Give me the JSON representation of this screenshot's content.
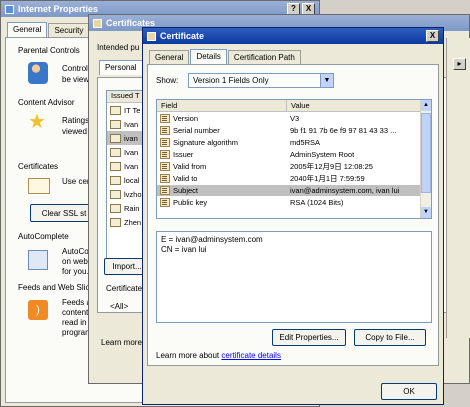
{
  "ie": {
    "title": "Internet Properties",
    "tabs": [
      "General",
      "Security"
    ],
    "sections": {
      "parental": {
        "heading": "Parental Controls",
        "line1": "Control",
        "line2": "be viewe"
      },
      "advisor": {
        "heading": "Content Advisor",
        "line1": "Ratings",
        "line2": "viewed o"
      },
      "certs": {
        "heading": "Certificates",
        "line1": "Use cert",
        "clear_ssl": "Clear SSL st"
      },
      "autocomplete": {
        "heading": "AutoComplete",
        "line1": "AutoCo",
        "line2": "on webp",
        "line3": "for you."
      },
      "feeds": {
        "heading": "Feeds and Web Slic",
        "line1": "Feeds a",
        "line2": "content",
        "line3": "read in I",
        "line4": "program"
      }
    }
  },
  "certs_dialog": {
    "title": "Certificates",
    "intended": "Intended pu",
    "tab_personal": "Personal",
    "issued_header": "Issued T",
    "items": [
      "IT Te",
      "Ivan",
      "ivan",
      "Ivan",
      "Ivan",
      "local",
      "lvzho",
      "Rain",
      "Zhen"
    ],
    "import_btn": "Import...",
    "purposes_label": "Certificate",
    "purposes_value": "<All>",
    "learn_more": "Learn more"
  },
  "cert": {
    "title": "Certificate",
    "tabs": [
      "General",
      "Details",
      "Certification Path"
    ],
    "show_label": "Show:",
    "show_value": "Version 1 Fields Only",
    "columns": {
      "field": "Field",
      "value": "Value"
    },
    "fields": [
      {
        "field": "Version",
        "value": "V3"
      },
      {
        "field": "Serial number",
        "value": "9b f1 91 7b 6e f9 97 81 43 33 ..."
      },
      {
        "field": "Signature algorithm",
        "value": "md5RSA"
      },
      {
        "field": "Issuer",
        "value": "AdminSystem Root"
      },
      {
        "field": "Valid from",
        "value": "2005年12月9日 12:08:25"
      },
      {
        "field": "Valid to",
        "value": "2040年1月1日 7:59:59"
      },
      {
        "field": "Subject",
        "value": "ivan@adminsystem.com, ivan lui"
      },
      {
        "field": "Public key",
        "value": "RSA (1024 Bits)"
      }
    ],
    "detail": {
      "line1": "E = ivan@adminsystem.com",
      "line2": "CN = ivan lui"
    },
    "edit_btn": "Edit Properties...",
    "copy_btn": "Copy to File...",
    "learn_prefix": "Learn more about ",
    "learn_link": "certificate details",
    "ok_btn": "OK"
  }
}
